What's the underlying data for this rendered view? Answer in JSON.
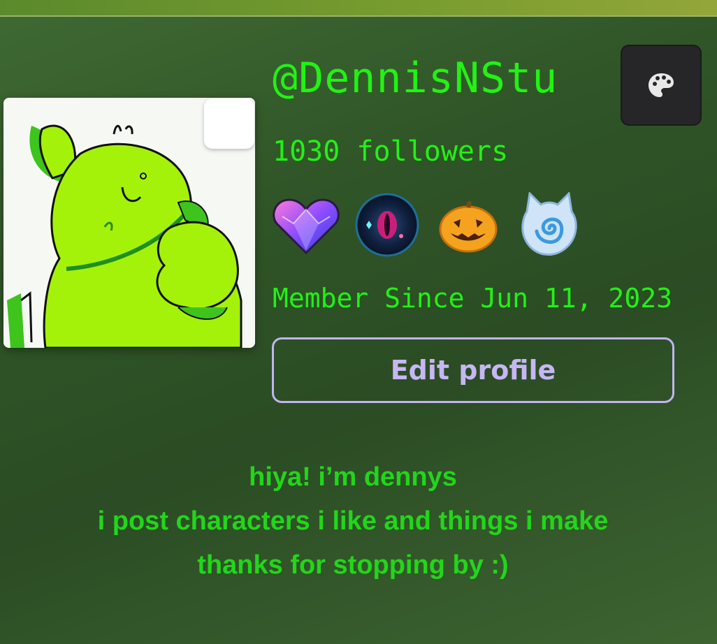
{
  "profile": {
    "username": "@DennisNStu",
    "followers_text": "1030 followers",
    "member_since": "Member Since Jun 11, 2023",
    "edit_button_label": "Edit profile",
    "avatar_icon": "green-creature-avatar",
    "theme_icon": "palette-icon"
  },
  "badges": [
    {
      "icon": "crystal-heart-icon"
    },
    {
      "icon": "dark-eye-orb-icon"
    },
    {
      "icon": "jack-o-lantern-icon"
    },
    {
      "icon": "ice-swirl-cat-icon"
    }
  ],
  "bio": {
    "lines": [
      "hiya! i’m dennys",
      "i post characters i like and things i make",
      "thanks for stopping by :)"
    ]
  },
  "colors": {
    "accent_green": "#22f214",
    "bio_green": "#22d61a",
    "button_lavender": "#c2b4f2",
    "background_dark_green": "#2f5427"
  }
}
